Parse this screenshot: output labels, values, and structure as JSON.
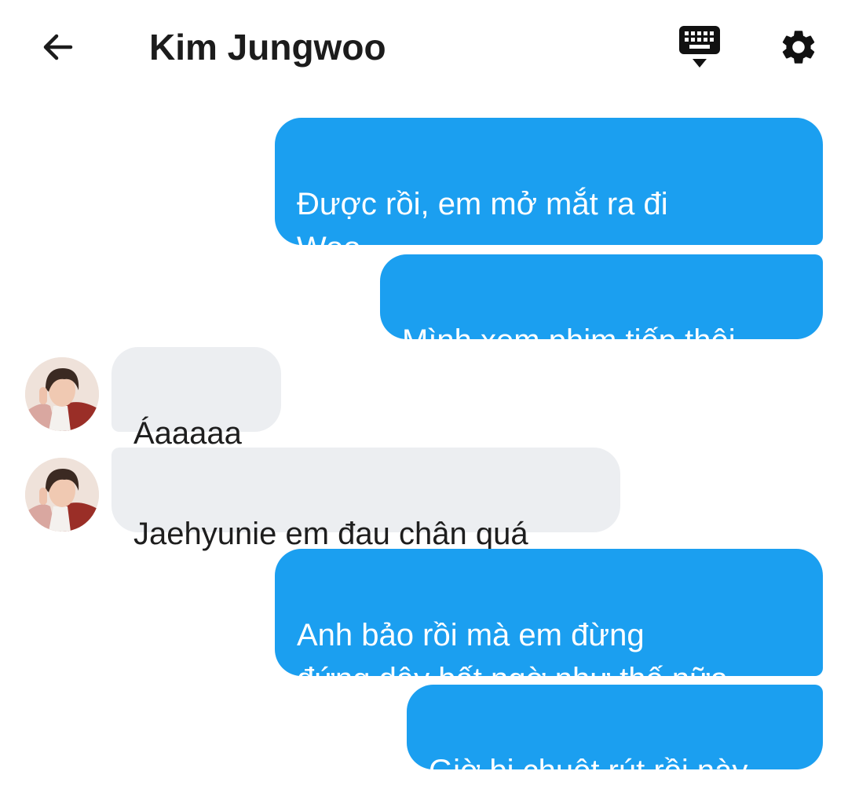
{
  "header": {
    "title": "Kim Jungwoo",
    "back_icon": "arrow-left-icon",
    "keyboard_icon": "keyboard-hide-icon",
    "settings_icon": "gear-icon"
  },
  "colors": {
    "outgoing_bubble": "#1b9ff0",
    "incoming_bubble": "#eceef1",
    "text_dark": "#1c1c1c"
  },
  "messages": [
    {
      "direction": "outgoing",
      "text": "Được rồi, em mở mắt ra đi\nWoo"
    },
    {
      "direction": "outgoing",
      "text": "Mình xem phim tiếp thôi"
    },
    {
      "direction": "incoming",
      "text": "Áaaaaa"
    },
    {
      "direction": "incoming",
      "text": "Jaehyunie em đau chân quá"
    },
    {
      "direction": "outgoing",
      "text": "Anh bảo rồi mà em đừng\nđứng dậy bất ngờ như thế nữa"
    },
    {
      "direction": "outgoing",
      "text": "Giờ bị chuột rút rồi này"
    }
  ]
}
